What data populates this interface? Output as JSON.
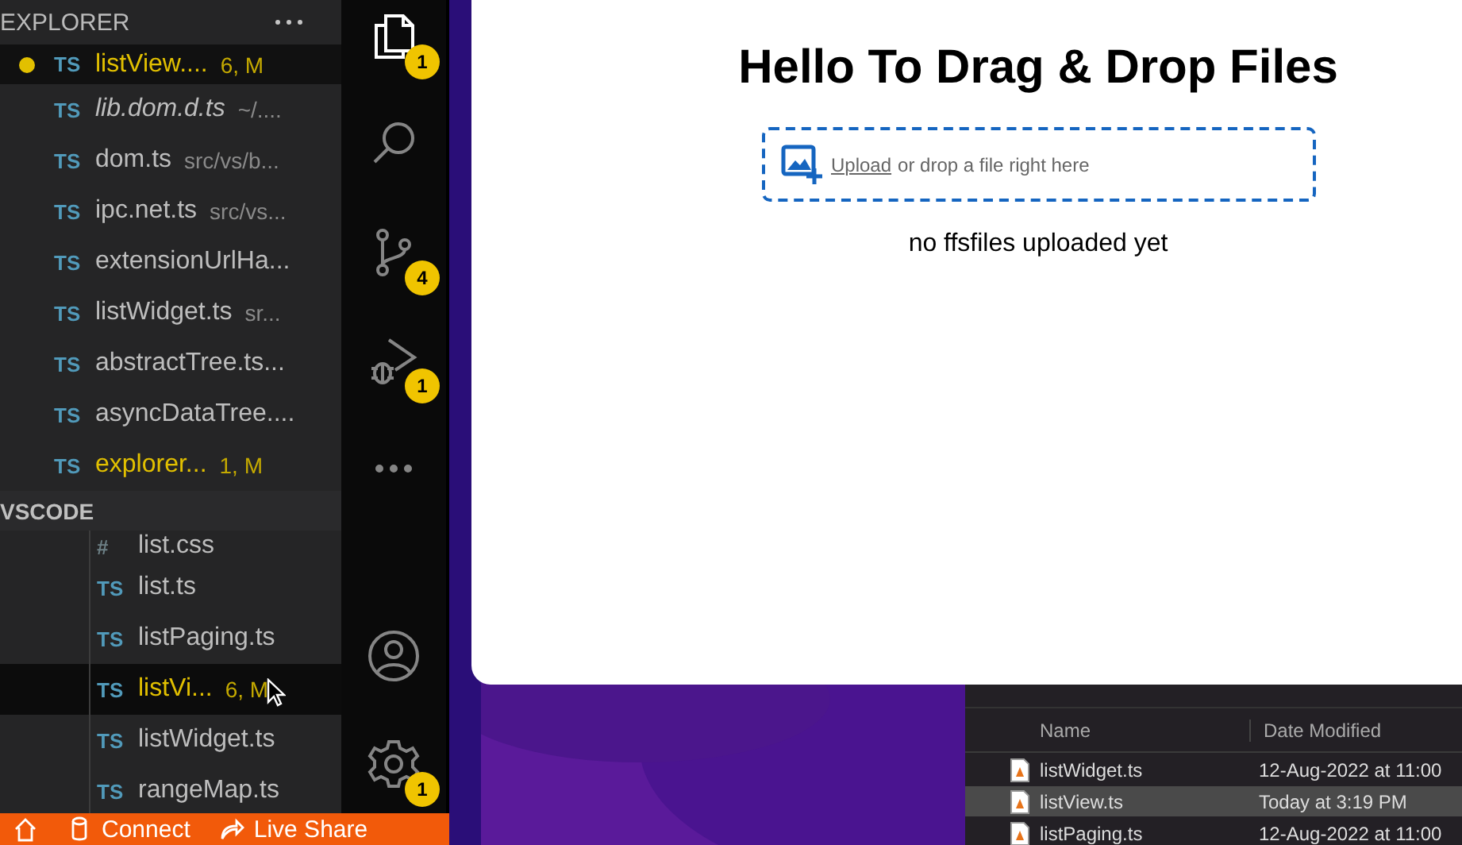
{
  "explorer": {
    "title": "EXPLORER",
    "open_editors": [
      {
        "kind": "ts",
        "icon_label": "TS",
        "name": "listView....",
        "detail": "6, M",
        "modified": true,
        "italic": false,
        "dirty": true,
        "selected": true
      },
      {
        "kind": "ts",
        "icon_label": "TS",
        "name": "lib.dom.d.ts",
        "detail": "~/....",
        "modified": false,
        "italic": true,
        "dirty": false,
        "selected": false
      },
      {
        "kind": "ts",
        "icon_label": "TS",
        "name": "dom.ts",
        "detail": "src/vs/b...",
        "modified": false,
        "italic": false,
        "dirty": false,
        "selected": false
      },
      {
        "kind": "ts",
        "icon_label": "TS",
        "name": "ipc.net.ts",
        "detail": "src/vs...",
        "modified": false,
        "italic": false,
        "dirty": false,
        "selected": false
      },
      {
        "kind": "ts",
        "icon_label": "TS",
        "name": "extensionUrlHa...",
        "modified": false,
        "italic": false,
        "dirty": false,
        "selected": false
      },
      {
        "kind": "ts",
        "icon_label": "TS",
        "name": "listWidget.ts",
        "detail": "sr...",
        "modified": false,
        "italic": false,
        "dirty": false,
        "selected": false
      },
      {
        "kind": "ts",
        "icon_label": "TS",
        "name": "abstractTree.ts...",
        "modified": false,
        "italic": false,
        "dirty": false,
        "selected": false
      },
      {
        "kind": "ts",
        "icon_label": "TS",
        "name": "asyncDataTree....",
        "modified": false,
        "italic": false,
        "dirty": false,
        "selected": false
      },
      {
        "kind": "ts",
        "icon_label": "TS",
        "name": "explorer...",
        "detail": "1, M",
        "modified": true,
        "italic": false,
        "dirty": false,
        "selected": false
      }
    ],
    "section": {
      "title": "VSCODE"
    },
    "tree": [
      {
        "kind": "css",
        "icon_label": "#",
        "name": "list.css",
        "modified": false,
        "selected": false
      },
      {
        "kind": "ts",
        "icon_label": "TS",
        "name": "list.ts",
        "modified": false,
        "selected": false
      },
      {
        "kind": "ts",
        "icon_label": "TS",
        "name": "listPaging.ts",
        "modified": false,
        "selected": false
      },
      {
        "kind": "ts",
        "icon_label": "TS",
        "name": "listVi...",
        "detail": "6, M",
        "modified": true,
        "selected": true
      },
      {
        "kind": "ts",
        "icon_label": "TS",
        "name": "listWidget.ts",
        "modified": false,
        "selected": false
      },
      {
        "kind": "ts",
        "icon_label": "TS",
        "name": "rangeMap.ts",
        "modified": false,
        "selected": false
      }
    ]
  },
  "activity_bar": {
    "top": [
      {
        "kind": "files",
        "badge": "1",
        "selected": true
      },
      {
        "kind": "search",
        "selected": false
      },
      {
        "kind": "source-control",
        "badge": "4",
        "selected": false
      },
      {
        "kind": "run-debug",
        "badge": "1",
        "selected": false
      },
      {
        "kind": "more",
        "selected": false
      }
    ],
    "bottom": [
      {
        "kind": "account",
        "selected": false
      },
      {
        "kind": "settings",
        "badge": "1",
        "selected": false
      }
    ]
  },
  "status_bar": [
    {
      "kind": "home"
    },
    {
      "kind": "connect",
      "label": "Connect"
    },
    {
      "kind": "live-share",
      "label": "Live Share"
    }
  ],
  "browser": {
    "heading": "Hello To Drag & Drop Files",
    "dropzone": {
      "link": "Upload",
      "text": "or drop a file right here"
    },
    "message": "no ffsfiles uploaded yet"
  },
  "finder": {
    "columns": [
      "Name",
      "Date Modified"
    ],
    "rows": [
      {
        "name": "listWidget.ts",
        "date": "12-Aug-2022 at 11:00",
        "selected": false
      },
      {
        "name": "listView.ts",
        "date": "Today at 3:19 PM",
        "selected": true
      },
      {
        "name": "listPaging.ts",
        "date": "12-Aug-2022 at 11:00",
        "selected": false
      }
    ]
  }
}
